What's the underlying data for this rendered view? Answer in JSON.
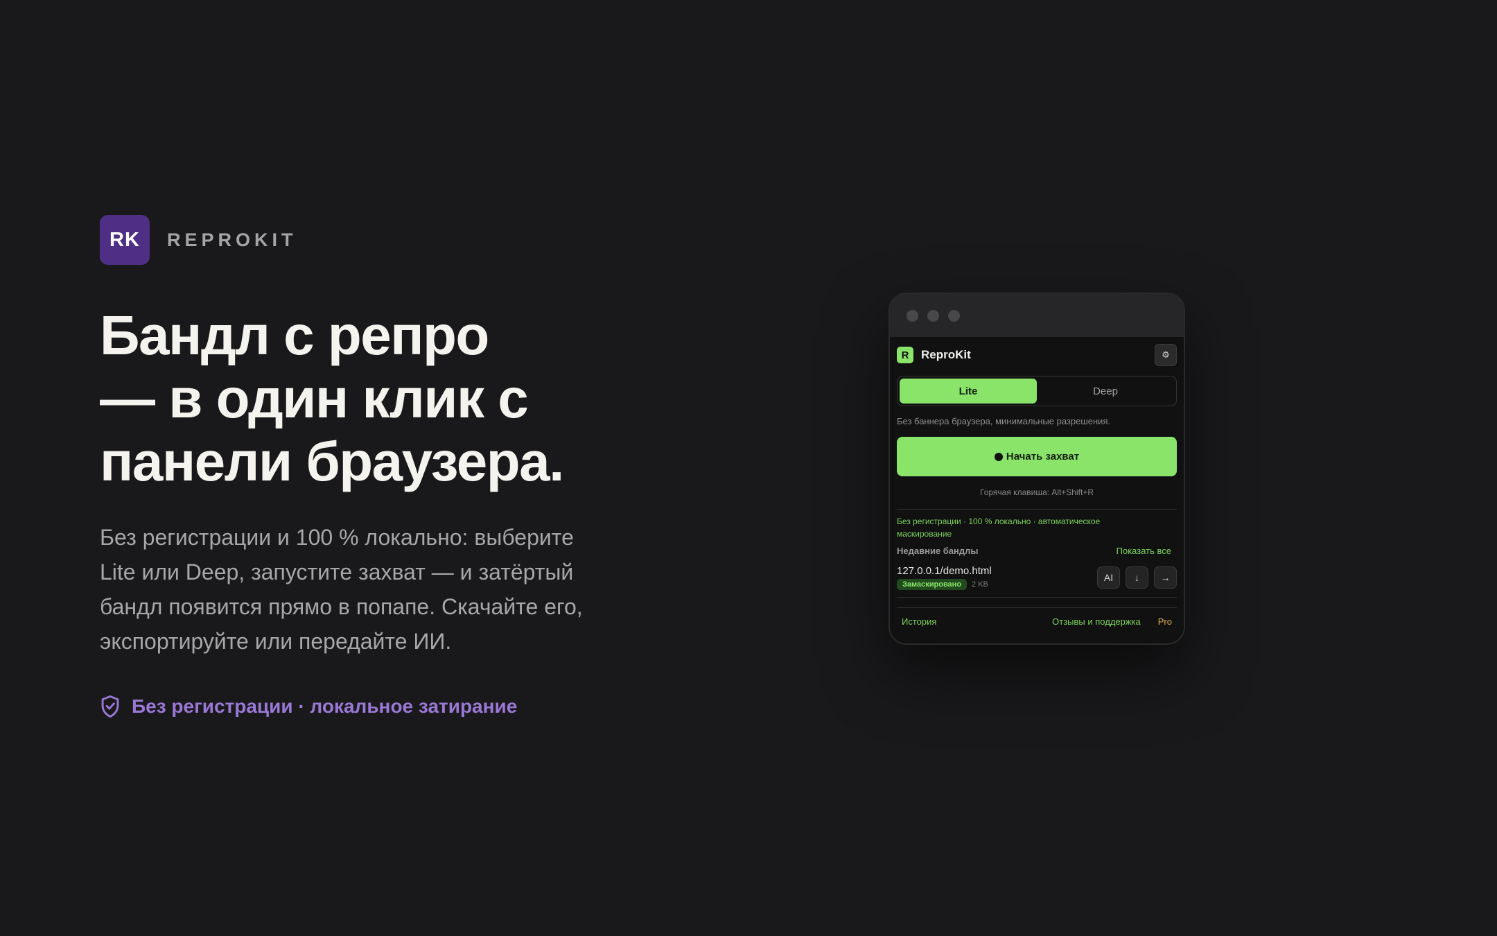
{
  "brand": {
    "logo_text": "RK",
    "name": "REPROKIT"
  },
  "hero": {
    "headline_lines": [
      "Бандл с репро",
      "— в один клик с",
      "панели браузера."
    ],
    "lead_lines": [
      "Без регистрации и 100 % локально: выберите",
      "Lite или Deep, запустите захват — и затёртый",
      "бандл появится прямо в попапе. Скачайте его,",
      "экспортируйте или передайте ИИ."
    ],
    "trust_text": "Без регистрации · локальное затирание",
    "trust_icon": "shield-check-icon",
    "accent_color": "#9a78d6"
  },
  "popup": {
    "logo_letter": "R",
    "title": "ReproKit",
    "settings_icon": "⚙",
    "modes": [
      "Lite",
      "Deep"
    ],
    "active_mode": "Lite",
    "mode_description": "Без баннера браузера, минимальные разрешения.",
    "start_button": "Начать захват",
    "hotkey": "Горячая клавиша: Alt+Shift+R",
    "privacy_note": "Без регистрации · 100 % локально · автоматическое маскирование",
    "recent": {
      "title": "Недавние бандлы",
      "show_all": "Показать все",
      "items": [
        {
          "url": "127.0.0.1/demo.html",
          "badge": "Замаскировано",
          "size": "2 KB",
          "actions": [
            "AI",
            "↓",
            "→"
          ]
        }
      ]
    },
    "footer": {
      "history": "История",
      "support": "Отзывы и поддержка",
      "pro": "Pro"
    },
    "accent_color": "#8ae46a",
    "pro_color": "#e3b34c"
  }
}
